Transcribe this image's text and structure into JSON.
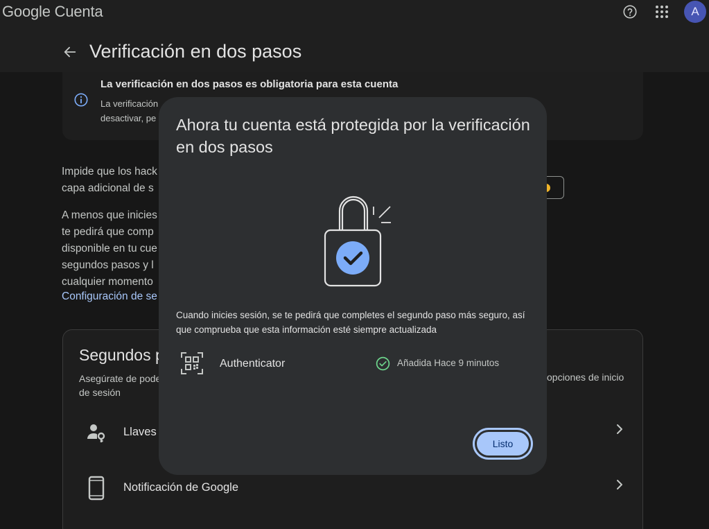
{
  "header": {
    "brand": "Google Cuenta",
    "avatar_letter": "A",
    "help_icon": "help-circle-icon",
    "apps_icon": "apps-grid-icon"
  },
  "page": {
    "title": "Verificación en dos pasos",
    "back_icon": "arrow-back-icon"
  },
  "info_banner": {
    "title": "La verificación en dos pasos es obligatoria para esta cuenta",
    "line1": "La verificación",
    "line2": "desactivar, pe",
    "icon": "info-icon"
  },
  "background": {
    "p1": [
      "Impide que los hack",
      "capa adicional de s"
    ],
    "p2": [
      "A menos que inicies",
      "te pedirá que comp",
      "disponible en tu cue",
      "segundos pasos y l",
      "cualquier momento"
    ],
    "link": "Configuración de se",
    "methods": {
      "title": "Segundos p",
      "desc_left": [
        "Asegúrate de pode",
        "de sesión"
      ],
      "desc_right": "opciones de inicio",
      "rows": [
        {
          "label": "Llaves d",
          "icon": "person-key-icon"
        },
        {
          "label": "Notificación de Google",
          "icon": "smartphone-icon"
        }
      ]
    }
  },
  "dialog": {
    "title": "Ahora tu cuenta está protegida por la verificación en dos pasos",
    "body": "Cuando inicies sesión, se te pedirá que completes el segundo paso más seguro, así que comprueba que esta información esté siempre actualizada",
    "method": {
      "name": "Authenticator",
      "icon": "qr-code-icon",
      "status": "Añadida Hace 9 minutos",
      "status_icon": "check-circle-icon",
      "status_color": "#6dd58c"
    },
    "done_label": "Listo"
  },
  "colors": {
    "accent": "#a8c7fa",
    "dialog_bg": "#2d2f31",
    "page_bg": "#1f1f1f"
  }
}
